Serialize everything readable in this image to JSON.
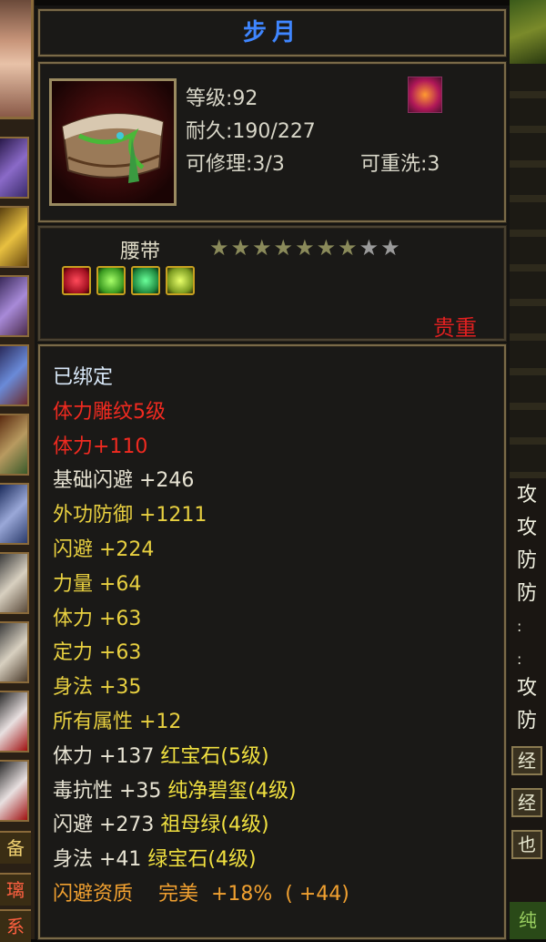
{
  "item": {
    "name": "步月",
    "level": "等级:92",
    "durability": "耐久:190/227",
    "repairable": "可修理:3/3",
    "rewashable": "可重洗:3",
    "type": "腰带",
    "quality": "贵重",
    "stars_total": 9,
    "stars_filled": 7,
    "gems": [
      "red",
      "green",
      "emerald",
      "yellow"
    ]
  },
  "attributes": [
    {
      "text": "已绑定",
      "color": "white"
    },
    {
      "text": "体力雕纹5级",
      "color": "red"
    },
    {
      "text": "体力+110",
      "color": "red"
    },
    {
      "text": "基础闪避  +246",
      "color": "light"
    },
    {
      "text": "外功防御  +1211",
      "color": "yellow"
    },
    {
      "text": "闪避  +224",
      "color": "yellow"
    },
    {
      "text": "力量  +64",
      "color": "yellow"
    },
    {
      "text": "体力  +63",
      "color": "yellow"
    },
    {
      "text": "定力  +63",
      "color": "yellow"
    },
    {
      "text": "身法  +35",
      "color": "yellow"
    },
    {
      "text": "所有属性  +12",
      "color": "yellow"
    },
    {
      "stat": "体力  +137",
      "gem": "红宝石(5级)"
    },
    {
      "stat": "毒抗性  +35",
      "gem": "纯净碧玺(4级)"
    },
    {
      "stat": "闪避  +273",
      "gem": "祖母绿(4级)"
    },
    {
      "stat": "身法  +41",
      "gem": "绿宝石(4级)"
    },
    {
      "text": "闪避资质    完美  +18%  ( +44)",
      "color": "orange"
    }
  ],
  "side": {
    "left_labels": [
      "备",
      "璃",
      "系"
    ],
    "right_chars": [
      "攻",
      "攻",
      "防",
      "防",
      ":",
      ":",
      "攻",
      "防"
    ],
    "right_boxes": [
      "经",
      "经",
      "也"
    ],
    "right_bottom": "纯"
  }
}
